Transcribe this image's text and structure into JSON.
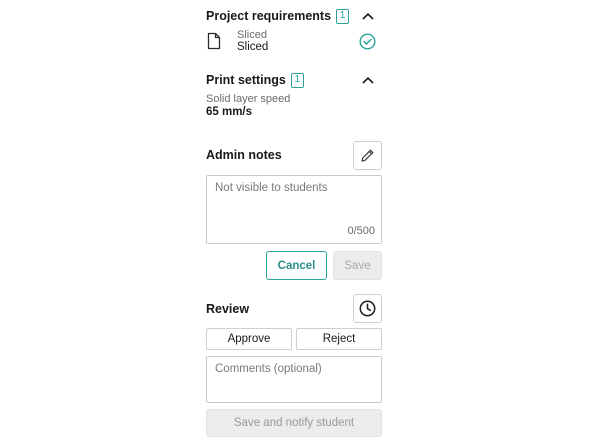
{
  "project_requirements": {
    "title": "Project requirements",
    "count": "1",
    "item": {
      "sub_label": "Sliced",
      "main_label": "Sliced",
      "icon": "file-icon",
      "status_icon": "check-circle-icon"
    }
  },
  "print_settings": {
    "title": "Print settings",
    "count": "1",
    "setting_label": "Solid layer speed",
    "setting_value": "65 mm/s"
  },
  "admin_notes": {
    "title": "Admin notes",
    "edit_icon": "pencil-icon",
    "placeholder": "Not visible to students",
    "value": "",
    "char_count": "0/500",
    "cancel_label": "Cancel",
    "save_label": "Save"
  },
  "review": {
    "title": "Review",
    "history_icon": "clock-icon",
    "approve_label": "Approve",
    "reject_label": "Reject",
    "comments_placeholder": "Comments (optional)",
    "notify_label": "Save and notify student"
  },
  "colors": {
    "accent": "#2aa39b",
    "disabled_bg": "#ececec",
    "border": "#cfcfcf"
  }
}
